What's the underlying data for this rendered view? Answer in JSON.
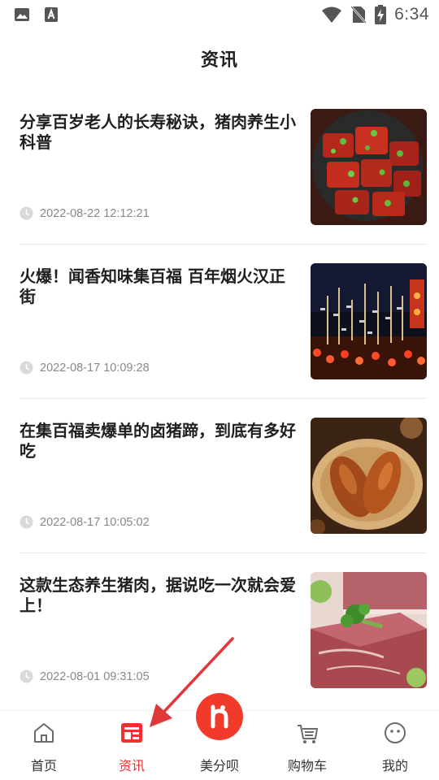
{
  "status_bar": {
    "time": "6:34",
    "left_icons": [
      "image-icon",
      "font-a-icon"
    ],
    "right_icons": [
      "wifi-icon",
      "no-sim-icon",
      "battery-charging-icon"
    ]
  },
  "header": {
    "title": "资讯"
  },
  "articles": [
    {
      "title": "分享百岁老人的长寿秘诀，猪肉养生小科普",
      "time": "2022-08-22 12:12:21",
      "thumb": "braised-pork"
    },
    {
      "title": "火爆！闻香知味集百福 百年烟火汉正街",
      "time": "2022-08-17 10:09:28",
      "thumb": "night-street"
    },
    {
      "title": "在集百福卖爆单的卤猪蹄，到底有多好吃",
      "time": "2022-08-17 10:05:02",
      "thumb": "braised-trotters"
    },
    {
      "title": "这款生态养生猪肉，据说吃一次就会爱上！",
      "time": "2022-08-01 09:31:05",
      "thumb": "raw-pork"
    }
  ],
  "bottom_nav": {
    "active": "资讯",
    "items": [
      {
        "label": "首页",
        "icon": "home-icon"
      },
      {
        "label": "资讯",
        "icon": "news-icon"
      },
      {
        "label": "美分呗",
        "icon": "meifenbei-logo-icon"
      },
      {
        "label": "购物车",
        "icon": "cart-icon"
      },
      {
        "label": "我的",
        "icon": "profile-face-icon"
      }
    ]
  },
  "colors": {
    "accent": "#f23030",
    "text_primary": "#1f1f1f",
    "text_secondary": "#888888",
    "annotation_arrow": "#e0373b"
  }
}
